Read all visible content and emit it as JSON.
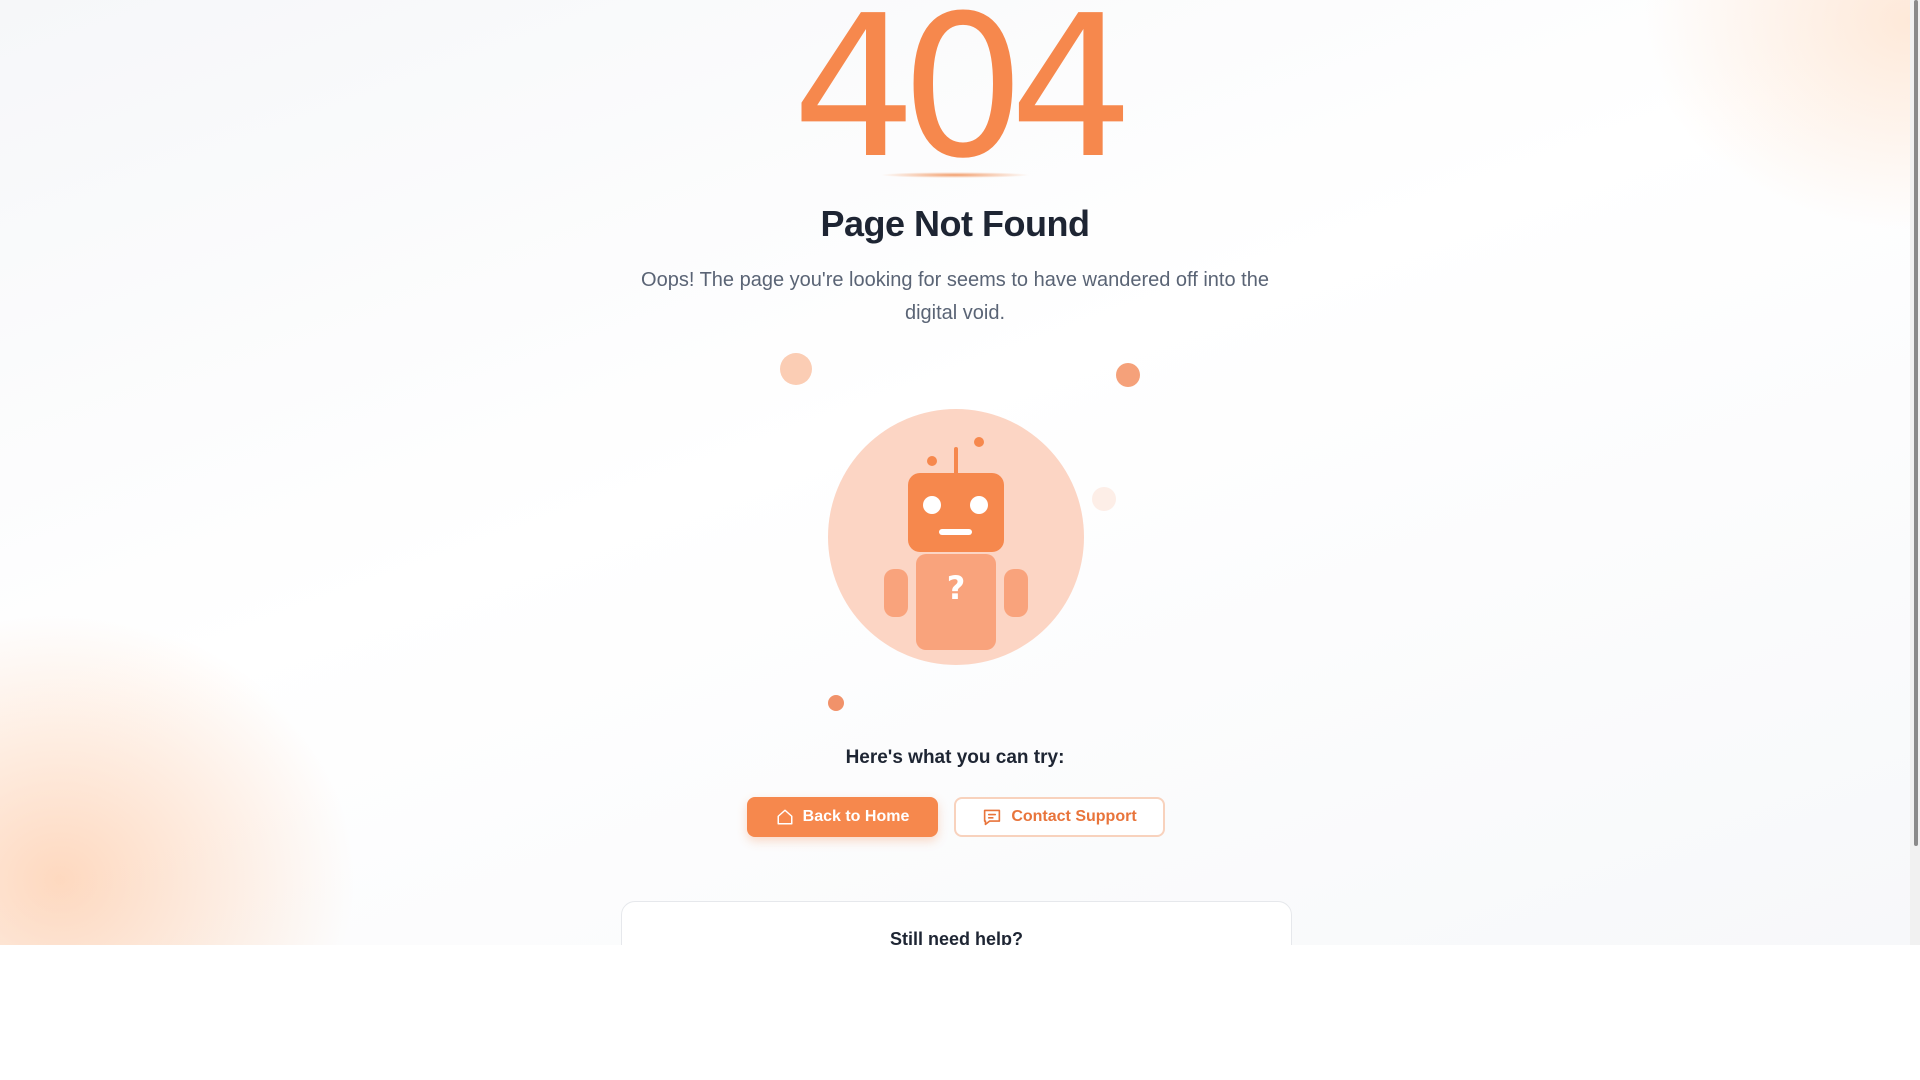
{
  "error": {
    "code": "404",
    "title": "Page Not Found",
    "message": "Oops! The page you're looking for seems to have wandered off into the digital void."
  },
  "illustration": {
    "icon": "confused-robot-icon",
    "body_glyph": "?"
  },
  "actions": {
    "heading": "Here's what you can try:",
    "home_label": "Back to Home",
    "home_icon": "home-icon",
    "support_label": "Contact Support",
    "support_icon": "message-icon"
  },
  "help": {
    "title": "Still need help?"
  },
  "colors": {
    "accent": "#f6884d",
    "accent_light": "#fcd5c4",
    "text_dark": "#1e2533",
    "text_muted": "#5a6475"
  }
}
